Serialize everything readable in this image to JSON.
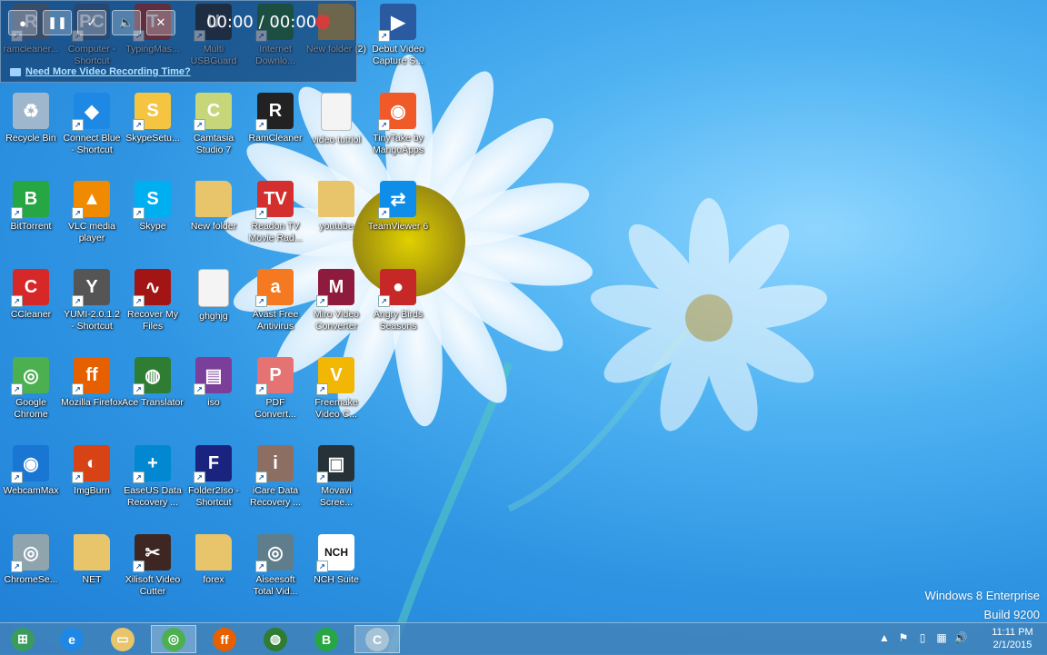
{
  "recorder": {
    "time": "00:00 / 00:00",
    "link_text": "Need More Video Recording Time?",
    "buttons": [
      {
        "icon": "record-icon",
        "glyph": "●"
      },
      {
        "icon": "pause-icon",
        "glyph": "❚❚"
      },
      {
        "icon": "checkmark-icon",
        "glyph": "✓"
      },
      {
        "icon": "volume-icon",
        "glyph": "🔈"
      },
      {
        "icon": "close-icon",
        "glyph": "✕"
      }
    ]
  },
  "desktop_icons": [
    {
      "label": "ramcleaner...",
      "icon": "ram-cleaner-icon",
      "color": "#6a7a8a",
      "glyph": "R",
      "col": 0,
      "row": 0
    },
    {
      "label": "Computer - Shortcut",
      "icon": "computer-shortcut-icon",
      "color": "#4a6f9a",
      "glyph": "PC",
      "col": 1,
      "row": 0
    },
    {
      "label": "TypingMas...",
      "icon": "typingmaster-icon",
      "color": "#c0392b",
      "glyph": "T",
      "col": 2,
      "row": 0
    },
    {
      "label": "Multi USBGuard",
      "icon": "usbguard-icon",
      "color": "#333333",
      "glyph": "U",
      "col": 3,
      "row": 0
    },
    {
      "label": "Internet Downlo...",
      "icon": "internet-download-manager-icon",
      "color": "#2e7d32",
      "glyph": "↓",
      "col": 4,
      "row": 0
    },
    {
      "label": "New folder (2)",
      "icon": "folder-icon",
      "color": "#e0b24a",
      "glyph": "",
      "col": 5,
      "row": 0
    },
    {
      "label": "Debut Video Capture S...",
      "icon": "debut-video-icon",
      "color": "#2a5aa0",
      "glyph": "▶",
      "col": 6,
      "row": 0
    },
    {
      "label": "Recycle Bin",
      "icon": "recycle-bin-icon",
      "color": "#9fb7cc",
      "glyph": "♻",
      "col": 0,
      "row": 1
    },
    {
      "label": "Connect Blue - Shortcut",
      "icon": "connect-blue-icon",
      "color": "#1e88e5",
      "glyph": "◆",
      "col": 1,
      "row": 1
    },
    {
      "label": "SkypeSetu...",
      "icon": "skype-setup-icon",
      "color": "#f5c542",
      "glyph": "S",
      "col": 2,
      "row": 1
    },
    {
      "label": "Camtasia Studio 7",
      "icon": "camtasia-icon",
      "color": "#c8d67a",
      "glyph": "C",
      "col": 3,
      "row": 1
    },
    {
      "label": "RamCleaner",
      "icon": "ram-cleaner-2-icon",
      "color": "#222222",
      "glyph": "R",
      "col": 4,
      "row": 1
    },
    {
      "label": "video tutriol",
      "icon": "text-file-icon",
      "color": "#f4f4f4",
      "glyph": "",
      "col": 5,
      "row": 1
    },
    {
      "label": "TinyTake by MangoApps",
      "icon": "tinytake-icon",
      "color": "#f05a28",
      "glyph": "◉",
      "col": 6,
      "row": 1
    },
    {
      "label": "BitTorrent",
      "icon": "bittorrent-icon",
      "color": "#27a744",
      "glyph": "B",
      "col": 0,
      "row": 2
    },
    {
      "label": "VLC media player",
      "icon": "vlc-icon",
      "color": "#f08a00",
      "glyph": "▲",
      "col": 1,
      "row": 2
    },
    {
      "label": "Skype",
      "icon": "skype-icon",
      "color": "#00aff0",
      "glyph": "S",
      "col": 2,
      "row": 2
    },
    {
      "label": "New folder",
      "icon": "folder-icon",
      "color": "#e8c46a",
      "glyph": "",
      "col": 3,
      "row": 2
    },
    {
      "label": "Readon TV Movie Rad...",
      "icon": "readon-tv-icon",
      "color": "#d32f2f",
      "glyph": "TV",
      "col": 4,
      "row": 2
    },
    {
      "label": "youtube",
      "icon": "folder-icon",
      "color": "#e8c46a",
      "glyph": "",
      "col": 5,
      "row": 2
    },
    {
      "label": "TeamViewer 6",
      "icon": "teamviewer-icon",
      "color": "#0e8ee9",
      "glyph": "⇄",
      "col": 6,
      "row": 2
    },
    {
      "label": "CCleaner",
      "icon": "ccleaner-icon",
      "color": "#d62828",
      "glyph": "C",
      "col": 0,
      "row": 3
    },
    {
      "label": "YUMI-2.0.1.2 - Shortcut",
      "icon": "yumi-icon",
      "color": "#555555",
      "glyph": "Y",
      "col": 1,
      "row": 3
    },
    {
      "label": "Recover My Files",
      "icon": "recover-my-files-icon",
      "color": "#a31515",
      "glyph": "∿",
      "col": 2,
      "row": 3
    },
    {
      "label": "ghghjg",
      "icon": "text-file-icon",
      "color": "#f4f4f4",
      "glyph": "",
      "col": 3,
      "row": 3
    },
    {
      "label": "Avast Free Antivirus",
      "icon": "avast-icon",
      "color": "#f47920",
      "glyph": "a",
      "col": 4,
      "row": 3
    },
    {
      "label": "Miro Video Converter",
      "icon": "miro-icon",
      "color": "#8e1b3e",
      "glyph": "M",
      "col": 5,
      "row": 3
    },
    {
      "label": "Angry Birds Seasons",
      "icon": "angry-birds-icon",
      "color": "#c62828",
      "glyph": "●",
      "col": 6,
      "row": 3
    },
    {
      "label": "Google Chrome",
      "icon": "chrome-icon",
      "color": "#4caf50",
      "glyph": "◎",
      "col": 0,
      "row": 4
    },
    {
      "label": "Mozilla Firefox",
      "icon": "firefox-icon",
      "color": "#e66000",
      "glyph": "ff",
      "col": 1,
      "row": 4
    },
    {
      "label": "Ace Translator",
      "icon": "globe-icon",
      "color": "#2e7d32",
      "glyph": "◍",
      "col": 2,
      "row": 4
    },
    {
      "label": "iso",
      "icon": "winrar-icon",
      "color": "#7b3f99",
      "glyph": "▤",
      "col": 3,
      "row": 4
    },
    {
      "label": "PDF Convert...",
      "icon": "pdf-converter-icon",
      "color": "#e57373",
      "glyph": "P",
      "col": 4,
      "row": 4
    },
    {
      "label": "Freemake Video C...",
      "icon": "freemake-icon",
      "color": "#f2b705",
      "glyph": "V",
      "col": 5,
      "row": 4
    },
    {
      "label": "WebcamMax",
      "icon": "webcammax-icon",
      "color": "#1976d2",
      "glyph": "◉",
      "col": 0,
      "row": 5
    },
    {
      "label": "ImgBurn",
      "icon": "imgburn-icon",
      "color": "#d84315",
      "glyph": "◐",
      "col": 1,
      "row": 5
    },
    {
      "label": "EaseUS Data Recovery ...",
      "icon": "easeus-icon",
      "color": "#0288d1",
      "glyph": "+",
      "col": 2,
      "row": 5
    },
    {
      "label": "Folder2Iso - Shortcut",
      "icon": "folder2iso-icon",
      "color": "#1a237e",
      "glyph": "F",
      "col": 3,
      "row": 5
    },
    {
      "label": "iCare Data Recovery ...",
      "icon": "icare-icon",
      "color": "#8d6e63",
      "glyph": "i",
      "col": 4,
      "row": 5
    },
    {
      "label": "Movavi Scree...",
      "icon": "movavi-icon",
      "color": "#263238",
      "glyph": "▣",
      "col": 5,
      "row": 5
    },
    {
      "label": "ChromeSe...",
      "icon": "chrome-setup-icon",
      "color": "#90a4ae",
      "glyph": "◎",
      "col": 0,
      "row": 6
    },
    {
      "label": "NET",
      "icon": "folder-icon",
      "color": "#e8c46a",
      "glyph": "",
      "col": 1,
      "row": 6
    },
    {
      "label": "Xilisoft Video Cutter",
      "icon": "xilisoft-icon",
      "color": "#3e2723",
      "glyph": "✂",
      "col": 2,
      "row": 6
    },
    {
      "label": "forex",
      "icon": "folder-icon",
      "color": "#e8c46a",
      "glyph": "",
      "col": 3,
      "row": 6
    },
    {
      "label": "Aiseesoft Total Vid...",
      "icon": "aiseesoft-icon",
      "color": "#607d8b",
      "glyph": "◎",
      "col": 4,
      "row": 6
    },
    {
      "label": "NCH Suite",
      "icon": "nch-suite-icon",
      "color": "#ffffff",
      "glyph": "NCH",
      "col": 5,
      "row": 6
    }
  ],
  "watermark": {
    "line1": "Windows 8 Enterprise",
    "line2": "Build 9200"
  },
  "taskbar": {
    "items": [
      {
        "name": "start-orb-icon",
        "color": "#3a9b5f",
        "glyph": "⊞",
        "active": false
      },
      {
        "name": "internet-explorer-icon",
        "color": "#1e88e5",
        "glyph": "e",
        "active": false
      },
      {
        "name": "file-explorer-icon",
        "color": "#e8c46a",
        "glyph": "▭",
        "active": false
      },
      {
        "name": "chrome-taskbar-icon",
        "color": "#4caf50",
        "glyph": "◎",
        "active": true
      },
      {
        "name": "firefox-taskbar-icon",
        "color": "#e66000",
        "glyph": "ff",
        "active": false
      },
      {
        "name": "globe-taskbar-icon",
        "color": "#2e7d32",
        "glyph": "◍",
        "active": false
      },
      {
        "name": "bittorrent-taskbar-icon",
        "color": "#27a744",
        "glyph": "B",
        "active": false
      },
      {
        "name": "camtasia-taskbar-icon",
        "color": "#a7c4d6",
        "glyph": "C",
        "active": true
      }
    ],
    "tray_icons": [
      {
        "name": "show-hidden-icons-icon",
        "glyph": "▲"
      },
      {
        "name": "flag-icon",
        "glyph": "⚑"
      },
      {
        "name": "device-icon",
        "glyph": "▯"
      },
      {
        "name": "network-icon",
        "glyph": "▦"
      },
      {
        "name": "volume-icon",
        "glyph": "🔊"
      }
    ],
    "time": "11:11 PM",
    "date": "2/1/2015"
  }
}
